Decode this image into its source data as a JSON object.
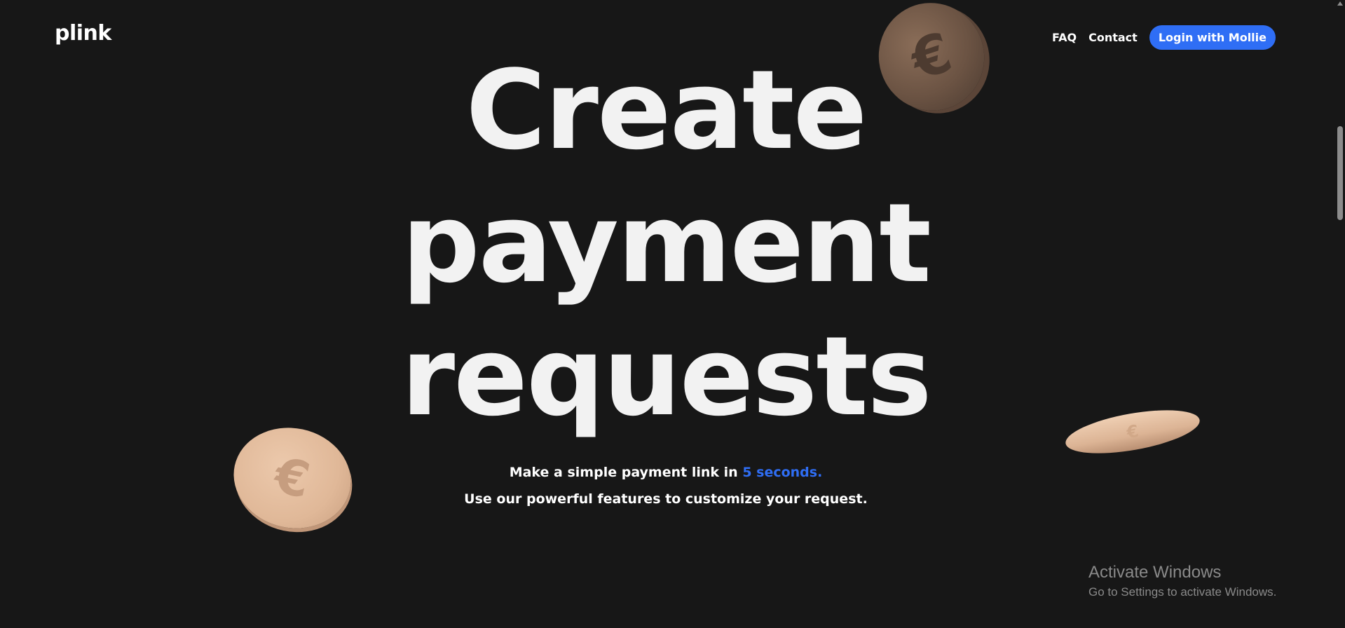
{
  "header": {
    "logo": "plink",
    "nav": {
      "faq": "FAQ",
      "contact": "Contact",
      "login_button": "Login with Mollie"
    }
  },
  "hero": {
    "line1": "Create",
    "line2": "payment",
    "line3": "requests",
    "subtitle_prefix": "Make a simple payment link in ",
    "subtitle_highlight": "5 seconds.",
    "subtitle_line2": "Use our powerful features to customize your request."
  },
  "coins": {
    "symbol": "€"
  },
  "watermark": {
    "title": "Activate Windows",
    "subtitle": "Go to Settings to activate Windows."
  },
  "colors": {
    "background": "#171717",
    "accent": "#2f6ef5",
    "text": "#ffffff"
  }
}
